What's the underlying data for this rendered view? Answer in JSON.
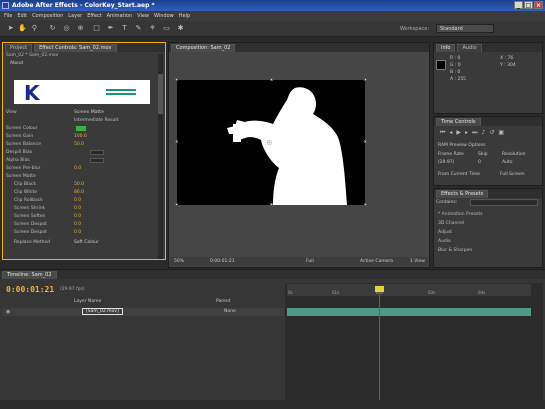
{
  "window": {
    "title": "Adobe After Effects - ColorKey_Start.aep *"
  },
  "menu": [
    "File",
    "Edit",
    "Composition",
    "Layer",
    "Effect",
    "Animation",
    "View",
    "Window",
    "Help"
  ],
  "toolbar": {
    "tools": [
      "selection-tool-icon",
      "hand-tool-icon",
      "zoom-tool-icon",
      "rotate-tool-icon",
      "orbit-camera-icon",
      "pan-behind-icon",
      "mask-tool-icon",
      "pen-tool-icon",
      "text-tool-icon",
      "brush-tool-icon",
      "clone-stamp-icon",
      "eraser-tool-icon",
      "puppet-pin-icon"
    ],
    "workspace_label": "Workspace:",
    "workspace_value": "Standard"
  },
  "left_panel": {
    "tabs": [
      "Project",
      "Effect Controls: Sam_02.mov"
    ],
    "header": "Sam_02 * Sam_02.mov",
    "section": "About",
    "logo_letter": "K",
    "rows": [
      {
        "label": "View",
        "value": "Screen Matte"
      },
      {
        "label": "Intermediate Result",
        "value": ""
      },
      {
        "label": "Screen Colour",
        "value": ""
      },
      {
        "label": "Screen Gain",
        "value": "100.0"
      },
      {
        "label": "Screen Balance",
        "value": "50.0"
      },
      {
        "label": "Despill Bias",
        "value": ""
      },
      {
        "label": "Alpha Bias",
        "value": ""
      },
      {
        "label": "Screen Pre-blur",
        "value": "0.0"
      },
      {
        "label": "Screen Matte",
        "value": ""
      },
      {
        "label": "Clip Black",
        "value": "50.0"
      },
      {
        "label": "Clip White",
        "value": "86.0"
      },
      {
        "label": "Clip Rollback",
        "value": "0.0"
      },
      {
        "label": "Screen Shrink",
        "value": "0.0"
      },
      {
        "label": "Screen Soften",
        "value": "0.0"
      },
      {
        "label": "Screen Despot",
        "value": "0.0"
      },
      {
        "label": "Screen Despot",
        "value": "0.0"
      },
      {
        "label": "Replace Method",
        "value": "Soft Colour"
      }
    ]
  },
  "comp": {
    "tab": "Composition: Sam_02",
    "viewer": {
      "zoom": "50%",
      "time": "0:00:01:21",
      "resolution": "Full",
      "camera": "Active Camera",
      "views": "1 View"
    }
  },
  "info": {
    "tabs": [
      "Info",
      "Audio"
    ],
    "r": "R : 0",
    "g": "G : 0",
    "b": "B : 0",
    "a": "A : 255",
    "x": "X : 76",
    "y": "Y : 304"
  },
  "preview": {
    "title": "Time Controls",
    "ram": "RAM Preview Options",
    "frame_rate_label": "Frame Rate",
    "skip_label": "Skip",
    "resolution_label": "Resolution",
    "frame_rate": "(29.97)",
    "skip": "0",
    "resolution": "Auto",
    "from_current": "From Current Time",
    "full_screen": "Full Screen"
  },
  "effects": {
    "title": "Effects & Presets",
    "search_label": "Contains:",
    "items": [
      "* Animation Presets",
      "3D Channel",
      "Adjust",
      "Audio",
      "Blur & Sharpen"
    ]
  },
  "timeline": {
    "tab": "Timeline: Sam_02",
    "timecode": "0:00:01:21",
    "fps_label": "(29.97 fps)",
    "col_layer": "Layer Name",
    "col_parent": "Parent",
    "layer_name": "[Sam_02.mov]",
    "parent_value": "None",
    "ticks": [
      "0s",
      "01s",
      "02s",
      "03s",
      "04s"
    ]
  },
  "colors": {
    "accent": "#f4b400",
    "cti": "#d23030",
    "layer_bar": "#4f9a87"
  }
}
